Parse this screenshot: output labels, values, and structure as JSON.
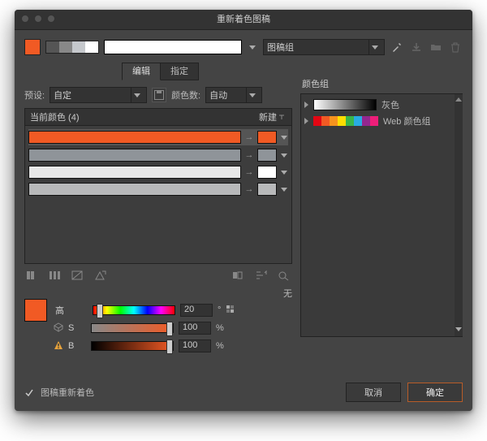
{
  "window": {
    "title": "重新着色图稿"
  },
  "toprow": {
    "group_select_value": "图稿组"
  },
  "tabs": {
    "edit": "编辑",
    "assign": "指定"
  },
  "preset": {
    "label": "预设:",
    "value": "自定",
    "colors_label": "颜色数:",
    "colors_value": "自动"
  },
  "current": {
    "label_prefix": "当前颜色",
    "count": "4",
    "new_label": "新建"
  },
  "rows": {
    "c0": "#f15a24",
    "c1": "#8f9499",
    "c2": "#e8e8e8",
    "c3b": "#b8b9ba"
  },
  "none_label": "无",
  "hsb": {
    "h_label": "高",
    "s_label": "S",
    "b_label": "B",
    "h_value": "20",
    "s_value": "100",
    "b_value": "100",
    "deg": "°",
    "pct": "%"
  },
  "right": {
    "section": "颜色组",
    "gray": "灰色",
    "web": "Web 颜色组"
  },
  "footer": {
    "recolor": "图稿重新着色",
    "cancel": "取消",
    "ok": "确定"
  }
}
